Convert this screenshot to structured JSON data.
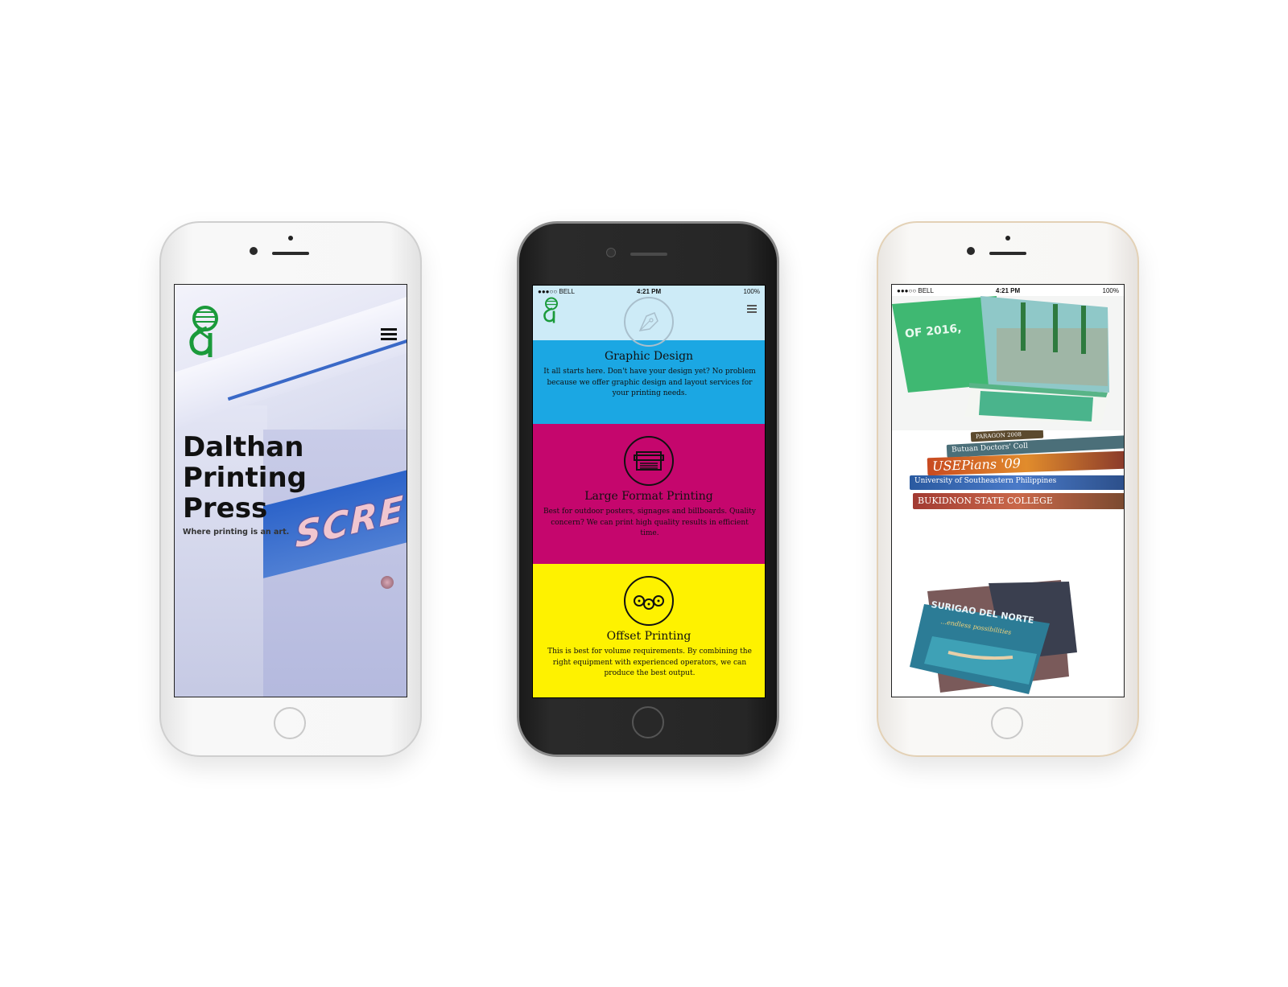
{
  "left_phone": {
    "title": "Dalthan Printing Press",
    "tagline": "Where printing is an art.",
    "machine_text": "SCRE",
    "icons": {
      "logo": "dalthan-logo-icon",
      "menu": "hamburger-menu-icon"
    }
  },
  "status_bar": {
    "carrier": "●●●○○ BELL",
    "time": "4:21 PM",
    "battery": "100%"
  },
  "center_phone": {
    "services": [
      {
        "title": "Graphic Design",
        "description": "It all starts here. Don't have your design yet? No problem because we offer graphic design and layout services for your printing needs.",
        "icon": "pen-nib-icon",
        "color": "#1ba7e3"
      },
      {
        "title": "Large Format Printing",
        "description": "Best for outdoor posters, signages and billboards. Quality concern? We can print high quality results in efficient time.",
        "icon": "large-printer-icon",
        "color": "#c5066d"
      },
      {
        "title": "Offset Printing",
        "description": "This is best for volume requirements. By combining the right equipment with experienced operators, we can produce the best output.",
        "icon": "offset-rollers-icon",
        "color": "#fef200"
      }
    ]
  },
  "right_phone": {
    "gallery": {
      "brochure_text": "OF 2016,",
      "books": [
        "PARAGON 2008",
        "Butuan Doctors' Coll",
        "USEPians '09",
        "University of Southeastern Philippines",
        "BUKIDNON STATE COLLEGE"
      ],
      "postcard_title": "SURIGAO DEL NORTE",
      "postcard_sub": "...endless possibilities"
    }
  },
  "colors": {
    "cyan": "#1ba7e3",
    "magenta": "#c5066d",
    "yellow": "#fef200",
    "logo_green": "#1a9a3a"
  }
}
